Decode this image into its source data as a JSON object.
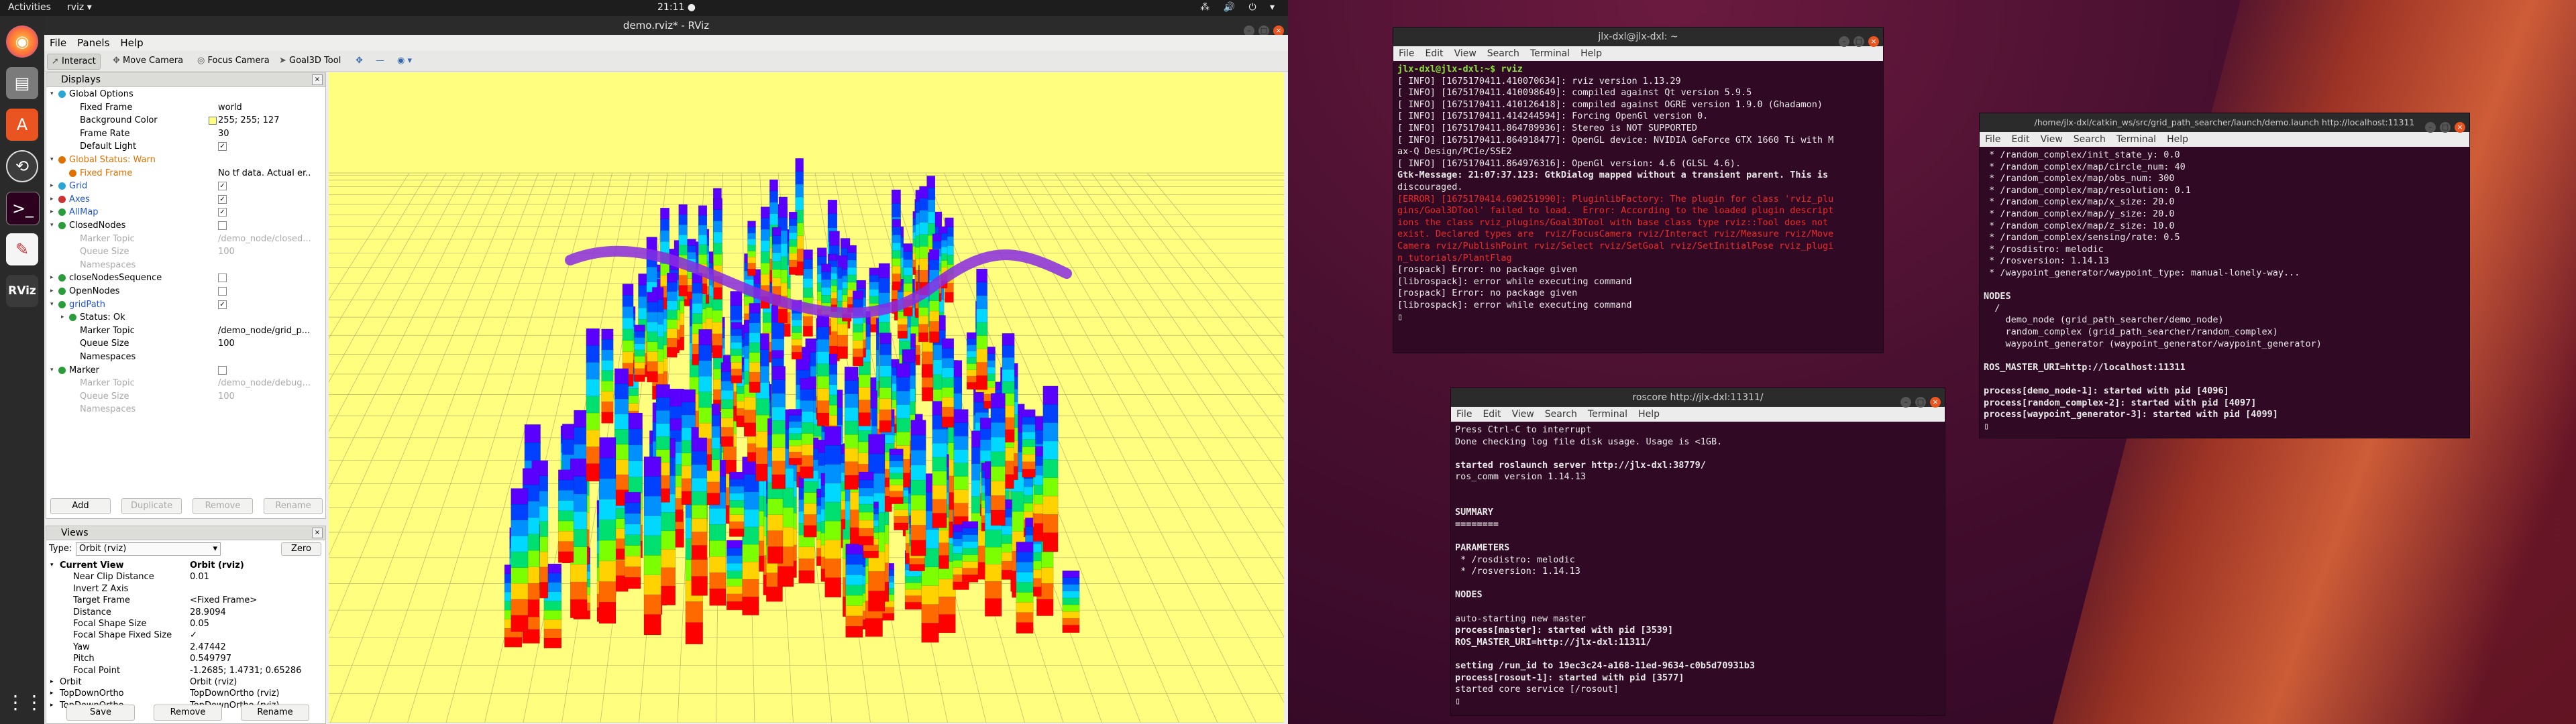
{
  "topbar": {
    "activities": "Activities",
    "app": "rviz ▾",
    "clock": "21:11 ●",
    "tray": "⁂ 🔊 ⏻ ▾"
  },
  "dock": {
    "icons": [
      "firefox-icon",
      "files-icon",
      "software-icon",
      "updates-icon",
      "terminal-icon",
      "text-editor-icon",
      "rviz-icon",
      "apps-grid-icon"
    ],
    "rviz_label": "RViz"
  },
  "rviz": {
    "title": "demo.rviz* - RViz",
    "menu": [
      "File",
      "Panels",
      "Help"
    ],
    "tools": [
      "Interact",
      "Move Camera",
      "Focus Camera",
      "Goal3D Tool",
      "✥",
      "—",
      "◉ ▾"
    ],
    "displays": {
      "header": "Displays",
      "rows": [
        {
          "name": "Global Options",
          "val": ""
        },
        {
          "name": "Fixed Frame",
          "val": "world"
        },
        {
          "name": "Background Color",
          "val": "255; 255; 127"
        },
        {
          "name": "Frame Rate",
          "val": "30"
        },
        {
          "name": "Default Light",
          "val": "✓"
        },
        {
          "name": "Global Status: Warn",
          "val": ""
        },
        {
          "name": "Fixed Frame",
          "val": "No tf data.  Actual er..."
        },
        {
          "name": "Grid",
          "val": "✓"
        },
        {
          "name": "Axes",
          "val": "✓"
        },
        {
          "name": "AllMap",
          "val": "✓"
        },
        {
          "name": "ClosedNodes",
          "val": ""
        },
        {
          "name": "Marker Topic",
          "val": "/demo_node/closed..."
        },
        {
          "name": "Queue Size",
          "val": "100"
        },
        {
          "name": "Namespaces",
          "val": ""
        },
        {
          "name": "closeNodesSequence",
          "val": ""
        },
        {
          "name": "OpenNodes",
          "val": ""
        },
        {
          "name": "gridPath",
          "val": "✓"
        },
        {
          "name": "Status: Ok",
          "val": ""
        },
        {
          "name": "Marker Topic",
          "val": "/demo_node/grid_p..."
        },
        {
          "name": "Queue Size",
          "val": "100"
        },
        {
          "name": "Namespaces",
          "val": ""
        },
        {
          "name": "Marker",
          "val": ""
        },
        {
          "name": "Marker Topic",
          "val": "/demo_node/debug..."
        },
        {
          "name": "Queue Size",
          "val": "100"
        },
        {
          "name": "Namespaces",
          "val": ""
        }
      ],
      "buttons": [
        "Add",
        "Duplicate",
        "Remove",
        "Rename"
      ]
    },
    "views": {
      "header": "Views",
      "type_label": "Type:",
      "type_value": "Orbit (rviz)",
      "zero": "Zero",
      "rows": [
        {
          "name": "Current View",
          "val": "Orbit (rviz)"
        },
        {
          "name": "Near Clip Distance",
          "val": "0.01"
        },
        {
          "name": "Invert Z Axis",
          "val": ""
        },
        {
          "name": "Target Frame",
          "val": "<Fixed Frame>"
        },
        {
          "name": "Distance",
          "val": "28.9094"
        },
        {
          "name": "Focal Shape Size",
          "val": "0.05"
        },
        {
          "name": "Focal Shape Fixed Size",
          "val": "✓"
        },
        {
          "name": "Yaw",
          "val": "2.47442"
        },
        {
          "name": "Pitch",
          "val": "0.549797"
        },
        {
          "name": "Focal Point",
          "val": "-1.2685; 1.4731; 0.65286"
        },
        {
          "name": "Orbit",
          "val": "Orbit (rviz)"
        },
        {
          "name": "TopDownOrtho",
          "val": "TopDownOrtho (rviz)"
        },
        {
          "name": "TopDownOrtho",
          "val": "TopDownOrtho (rviz)"
        }
      ],
      "buttons": [
        "Save",
        "Remove",
        "Rename"
      ]
    },
    "background_color": "#fffe7f"
  },
  "term1": {
    "title": "jlx-dxl@jlx-dxl: ~",
    "menu": [
      "File",
      "Edit",
      "View",
      "Search",
      "Terminal",
      "Help"
    ],
    "lines": [
      "jlx-dxl@jlx-dxl:~$ rviz",
      "[ INFO] [1675170411.410070634]: rviz version 1.13.29",
      "[ INFO] [1675170411.410098649]: compiled against Qt version 5.9.5",
      "[ INFO] [1675170411.410126418]: compiled against OGRE version 1.9.0 (Ghadamon)",
      "[ INFO] [1675170411.414244594]: Forcing OpenGl version 0.",
      "[ INFO] [1675170411.864789936]: Stereo is NOT SUPPORTED",
      "[ INFO] [1675170411.864918477]: OpenGL device: NVIDIA GeForce GTX 1660 Ti with M",
      "ax-Q Design/PCIe/SSE2",
      "[ INFO] [1675170411.864976316]: OpenGl version: 4.6 (GLSL 4.6).",
      "Gtk-Message: 21:07:37.123: GtkDialog mapped without a transient parent. This is",
      "discouraged.",
      "[ERROR] [1675170414.690251990]: PluginlibFactory: The plugin for class 'rviz_plu",
      "gins/Goal3DTool' failed to load.  Error: According to the loaded plugin descript",
      "ions the class rviz_plugins/Goal3DTool with base class type rviz::Tool does not",
      "exist. Declared types are  rviz/FocusCamera rviz/Interact rviz/Measure rviz/Move",
      "Camera rviz/PublishPoint rviz/Select rviz/SetGoal rviz/SetInitialPose rviz_plugi",
      "n_tutorials/PlantFlag",
      "[rospack] Error: no package given",
      "[librospack]: error while executing command",
      "[rospack] Error: no package given",
      "[librospack]: error while executing command",
      "▯"
    ]
  },
  "term2": {
    "title": "roscore http://jlx-dxl:11311/",
    "menu": [
      "File",
      "Edit",
      "View",
      "Search",
      "Terminal",
      "Help"
    ],
    "lines": [
      "Press Ctrl-C to interrupt",
      "Done checking log file disk usage. Usage is <1GB.",
      "",
      "started roslaunch server http://jlx-dxl:38779/",
      "ros_comm version 1.14.13",
      "",
      "",
      "SUMMARY",
      "========",
      "",
      "PARAMETERS",
      " * /rosdistro: melodic",
      " * /rosversion: 1.14.13",
      "",
      "NODES",
      "",
      "auto-starting new master",
      "process[master]: started with pid [3539]",
      "ROS_MASTER_URI=http://jlx-dxl:11311/",
      "",
      "setting /run_id to 19ec3c24-a168-11ed-9634-c0b5d70931b3",
      "process[rosout-1]: started with pid [3577]",
      "started core service [/rosout]",
      "▯"
    ]
  },
  "term3": {
    "title": "/home/jlx-dxl/catkin_ws/src/grid_path_searcher/launch/demo.launch http://localhost:11311",
    "menu": [
      "File",
      "Edit",
      "View",
      "Search",
      "Terminal",
      "Help"
    ],
    "lines": [
      " * /random_complex/init_state_y: 0.0",
      " * /random_complex/map/circle_num: 40",
      " * /random_complex/map/obs_num: 300",
      " * /random_complex/map/resolution: 0.1",
      " * /random_complex/map/x_size: 20.0",
      " * /random_complex/map/y_size: 20.0",
      " * /random_complex/map/z_size: 10.0",
      " * /random_complex/sensing/rate: 0.5",
      " * /rosdistro: melodic",
      " * /rosversion: 1.14.13",
      " * /waypoint_generator/waypoint_type: manual-lonely-way...",
      "",
      "NODES",
      "  /",
      "    demo_node (grid_path_searcher/demo_node)",
      "    random_complex (grid_path_searcher/random_complex)",
      "    waypoint_generator (waypoint_generator/waypoint_generator)",
      "",
      "ROS_MASTER_URI=http://localhost:11311",
      "",
      "process[demo_node-1]: started with pid [4096]",
      "process[random_complex-2]: started with pid [4097]",
      "process[waypoint_generator-3]: started with pid [4099]",
      "▯"
    ]
  }
}
